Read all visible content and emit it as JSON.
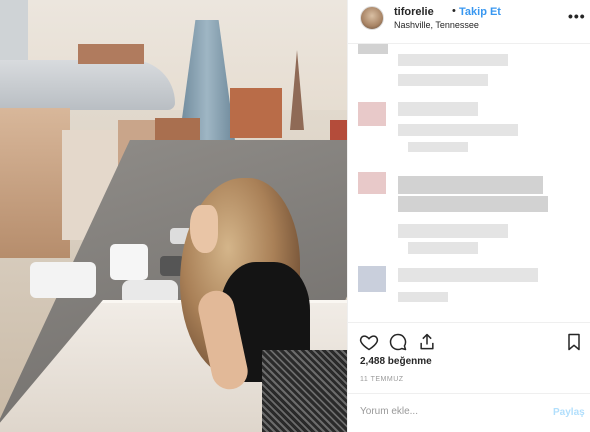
{
  "post": {
    "username": "tiforelie",
    "separator": "•",
    "follow_label": "Takip Et",
    "location": "Nashville, Tennessee",
    "more_label": "•••",
    "likes": "2,488 beğenme",
    "date": "11 TEMMUZ",
    "comment_placeholder": "Yorum ekle...",
    "post_label": "Paylaş"
  },
  "icons": {
    "like": "heart-icon",
    "comment": "comment-icon",
    "share": "share-icon",
    "save": "bookmark-icon"
  },
  "colors": {
    "accent": "#3897f0",
    "post_disabled": "#b2dffc",
    "muted": "#999999",
    "text": "#262626"
  }
}
